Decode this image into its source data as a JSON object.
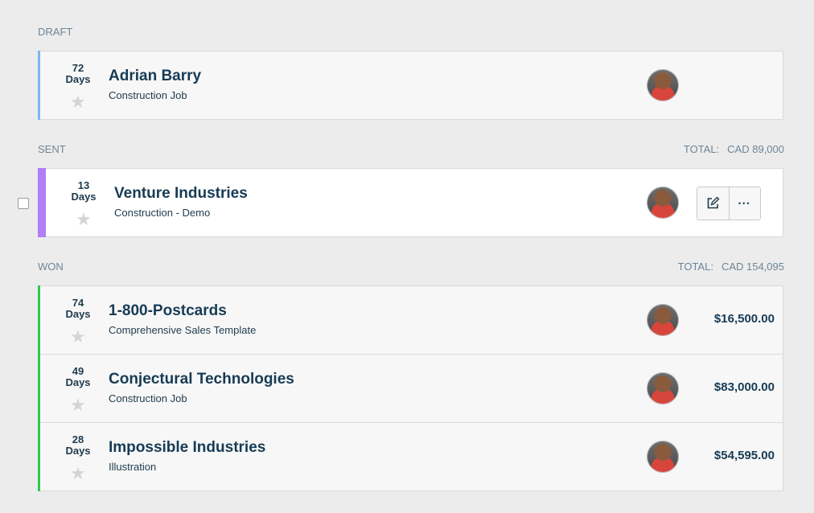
{
  "sections": {
    "draft": {
      "label": "DRAFT",
      "deals": [
        {
          "days_num": "72",
          "days_unit": "Days",
          "name": "Adrian Barry",
          "subtitle": "Construction Job",
          "amount": "",
          "accent_color": "#7fb5f2"
        }
      ]
    },
    "sent": {
      "label": "SENT",
      "total_label": "TOTAL:",
      "total_value": "CAD 89,000",
      "deals": [
        {
          "days_num": "13",
          "days_unit": "Days",
          "name": "Venture Industries",
          "subtitle": "Construction - Demo",
          "amount": "",
          "accent_color": "#b27ef5"
        }
      ]
    },
    "won": {
      "label": "WON",
      "total_label": "TOTAL:",
      "total_value": "CAD 154,095",
      "deals": [
        {
          "days_num": "74",
          "days_unit": "Days",
          "name": "1-800-Postcards",
          "subtitle": "Comprehensive Sales Template",
          "amount": "$16,500.00",
          "accent_color": "#2ec94a"
        },
        {
          "days_num": "49",
          "days_unit": "Days",
          "name": "Conjectural Technologies",
          "subtitle": "Construction Job",
          "amount": "$83,000.00",
          "accent_color": "#2ec94a"
        },
        {
          "days_num": "28",
          "days_unit": "Days",
          "name": "Impossible Industries",
          "subtitle": "Illustration",
          "amount": "$54,595.00",
          "accent_color": "#2ec94a"
        }
      ]
    }
  },
  "icons": {
    "star": "star-icon",
    "edit": "edit-icon",
    "more": "more-icon"
  },
  "glyphs": {
    "star": "★",
    "more": "•••"
  }
}
